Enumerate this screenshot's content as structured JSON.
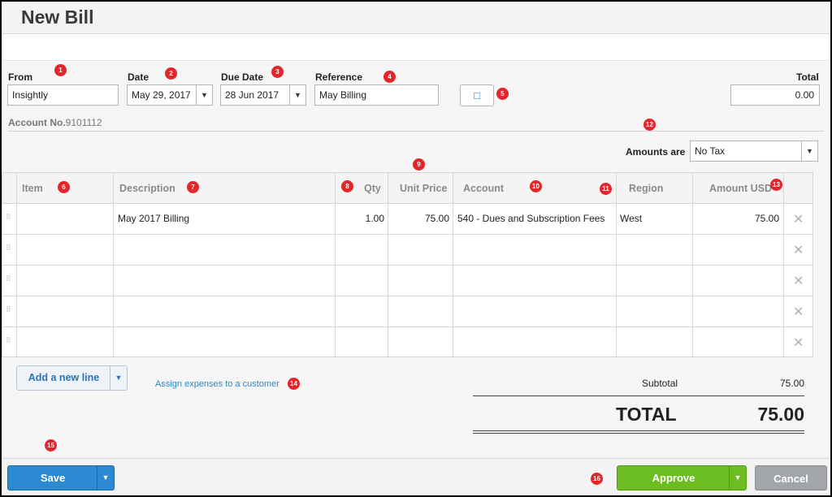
{
  "page": {
    "title": "New Bill"
  },
  "form": {
    "from_label": "From",
    "from_value": "Insightly",
    "date_label": "Date",
    "date_value": "May 29, 2017",
    "due_date_label": "Due Date",
    "due_date_value": "28 Jun 2017",
    "reference_label": "Reference",
    "reference_value": "May Billing",
    "total_label": "Total",
    "total_value": "0.00",
    "account_no_label": "Account No.",
    "account_no_value": "9101112",
    "amounts_are_label": "Amounts are",
    "amounts_are_value": "No Tax"
  },
  "table": {
    "headers": {
      "item": "Item",
      "description": "Description",
      "qty": "Qty",
      "unit_price": "Unit Price",
      "account": "Account",
      "region": "Region",
      "amount": "Amount USD"
    },
    "rows": [
      {
        "item": "",
        "description": "May 2017 Billing",
        "qty": "1.00",
        "unit_price": "75.00",
        "account": "540 - Dues and Subscription Fees",
        "region": "West",
        "amount": "75.00"
      },
      {
        "item": "",
        "description": "",
        "qty": "",
        "unit_price": "",
        "account": "",
        "region": "",
        "amount": ""
      },
      {
        "item": "",
        "description": "",
        "qty": "",
        "unit_price": "",
        "account": "",
        "region": "",
        "amount": ""
      },
      {
        "item": "",
        "description": "",
        "qty": "",
        "unit_price": "",
        "account": "",
        "region": "",
        "amount": ""
      },
      {
        "item": "",
        "description": "",
        "qty": "",
        "unit_price": "",
        "account": "",
        "region": "",
        "amount": ""
      }
    ],
    "remove_glyph": "✕"
  },
  "actions": {
    "add_line": "Add a new line",
    "assign_link": "Assign expenses to a customer",
    "save": "Save",
    "approve": "Approve",
    "cancel": "Cancel"
  },
  "totals": {
    "subtotal_label": "Subtotal",
    "subtotal_value": "75.00",
    "total_label": "TOTAL",
    "total_value": "75.00"
  },
  "markers": [
    "1",
    "2",
    "3",
    "4",
    "5",
    "6",
    "7",
    "8",
    "9",
    "10",
    "11",
    "12",
    "13",
    "14",
    "15",
    "16"
  ],
  "colors": {
    "accent_blue": "#2b8ad1",
    "approve_green": "#6cbd22",
    "marker_red": "#e2262b"
  }
}
